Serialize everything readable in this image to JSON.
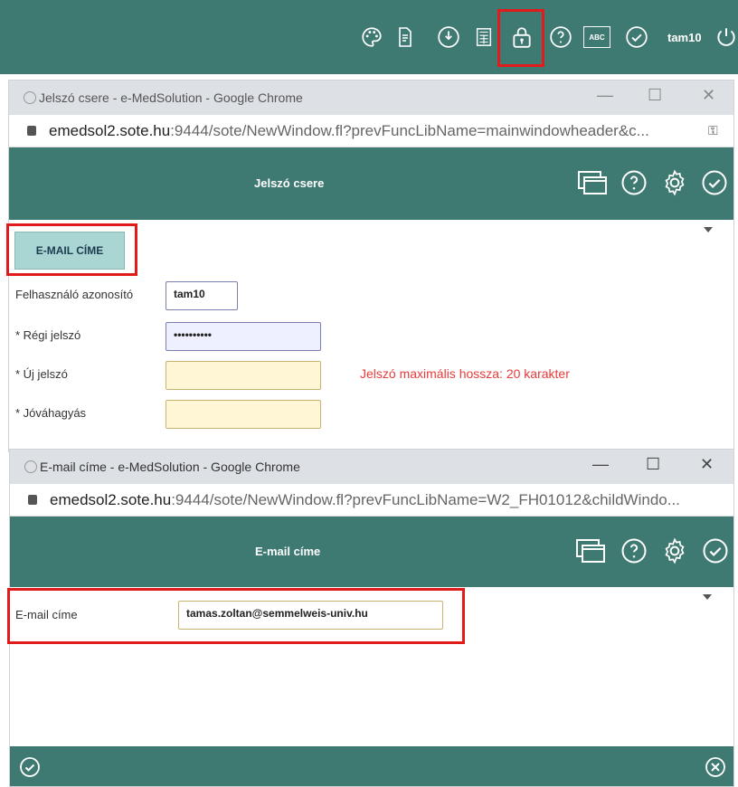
{
  "topbar": {
    "user": "tam10",
    "icons": [
      "palette-icon",
      "document-icon",
      "download-icon",
      "calculator-icon",
      "lock-icon",
      "help-icon",
      "spellcheck-icon",
      "check-icon",
      "power-icon"
    ],
    "spell_label": "ABC"
  },
  "pw_window": {
    "title": "Jelszó csere - e-MedSolution - Google Chrome",
    "url_host": "emedsol2.sote.hu",
    "url_rest": ":9444/sote/NewWindow.fl?prevFuncLibName=mainwindowheader&c...",
    "header_title": "Jelszó csere",
    "email_button": "E-MAIL CÍME",
    "fields": {
      "user_label": "Felhasználó azonosító",
      "user_value": "tam10",
      "old_label": "* Régi jelszó",
      "old_value": "••••••••••",
      "new_label": "* Új jelszó",
      "new_value": "",
      "confirm_label": "* Jóváhagyás",
      "confirm_value": ""
    },
    "error": "Jelszó maximális hossza: 20 karakter"
  },
  "email_window": {
    "title": "E-mail címe - e-MedSolution - Google Chrome",
    "url_host": "emedsol2.sote.hu",
    "url_rest": ":9444/sote/NewWindow.fl?prevFuncLibName=W2_FH01012&childWindo...",
    "header_title": "E-mail címe",
    "email_label": "E-mail címe",
    "email_value": "tamas.zoltan@semmelweis-univ.hu"
  },
  "window_controls": {
    "minimize": "—",
    "maximize": "☐",
    "close": "✕"
  },
  "colors": {
    "header": "#3e7a72",
    "highlight": "#e01b1b",
    "button": "#a9d6d3",
    "input_yellow": "#fff6d5",
    "input_blue": "#eef0ff"
  }
}
